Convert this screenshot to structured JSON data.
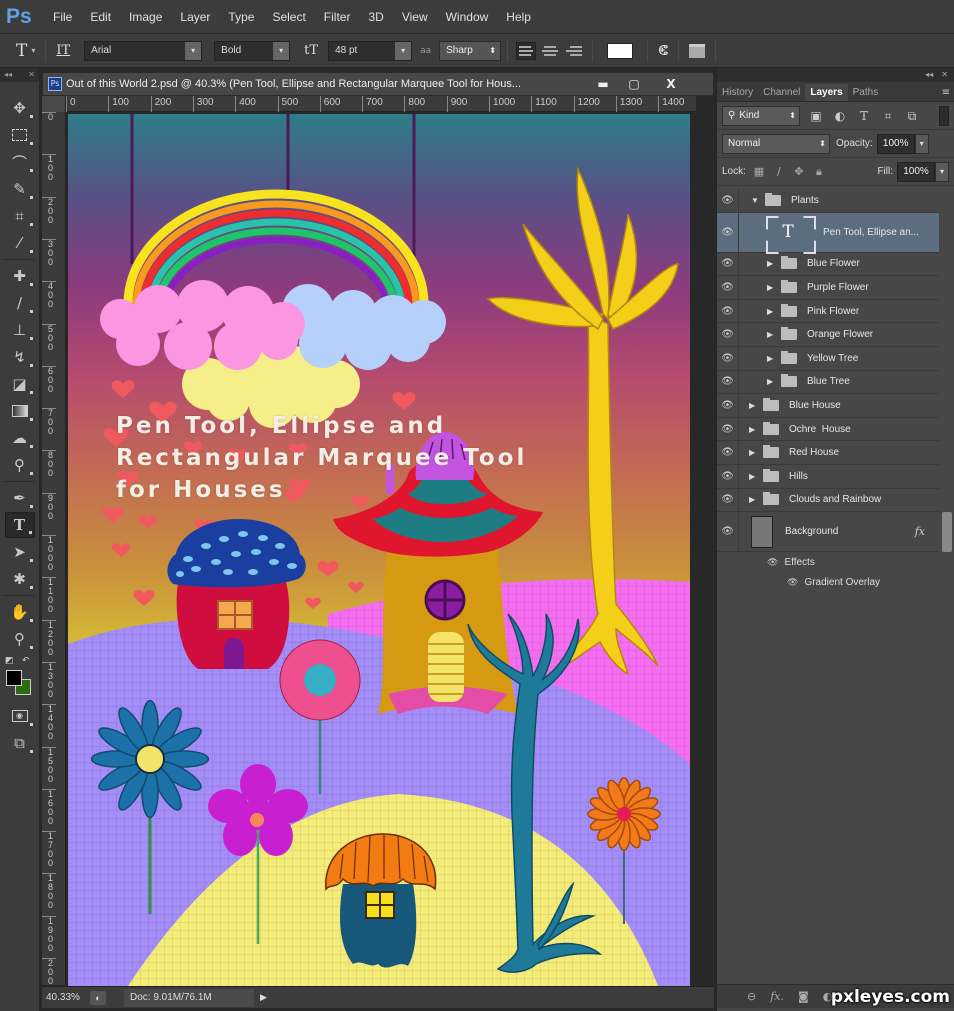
{
  "app": {
    "logo": "Ps",
    "watermark": "pxleyes.com"
  },
  "menu": [
    "File",
    "Edit",
    "Image",
    "Layer",
    "Type",
    "Select",
    "Filter",
    "3D",
    "View",
    "Window",
    "Help"
  ],
  "options": {
    "tool_icon": "T",
    "orientation_icon": "IT",
    "font_family": "Arial",
    "font_style": "Bold",
    "size_icon": "tT",
    "font_size": "48 pt",
    "aa_icon": "aa",
    "antialias": "Sharp",
    "alignment": [
      "left",
      "center",
      "right"
    ],
    "active_alignment": "left",
    "text_color": "#ffffff"
  },
  "document": {
    "title": "Out of this World 2.psd @ 40.3% (Pen Tool, Ellipse and  Rectangular Marquee Tool for Hous...",
    "icon": "Ps",
    "minimize": "▬",
    "maximize": "▢",
    "close": "X",
    "h_ruler": [
      "0",
      "100",
      "200",
      "300",
      "400",
      "500",
      "600",
      "700",
      "800",
      "900",
      "1000",
      "1100",
      "1200",
      "1300",
      "1400"
    ],
    "v_ruler": [
      "0",
      "100",
      "200",
      "300",
      "400",
      "500",
      "600",
      "700",
      "800",
      "900",
      "1000",
      "1100",
      "1200",
      "1300",
      "1400",
      "1500",
      "1600",
      "1700",
      "1800",
      "1900",
      "2000"
    ],
    "canvas_text": [
      "Pen Tool, Ellipse and",
      "Rectangular Marquee Tool",
      "for Houses"
    ],
    "zoom": "40.33%",
    "doc_info": "Doc: 9.01M/76.1M",
    "more": "▶"
  },
  "tools": [
    "move",
    "rectangular-marquee",
    "lasso",
    "quick-selection",
    "crop",
    "eyedropper",
    "spot-healing",
    "brush",
    "clone-stamp",
    "history-brush",
    "eraser",
    "gradient",
    "blur",
    "dodge",
    "pen",
    "type",
    "path-selection",
    "custom-shape",
    "hand",
    "zoom"
  ],
  "active_tool": "type",
  "colors": {
    "foreground": "#000000",
    "background": "#2d6b10"
  },
  "panel": {
    "tabs": [
      "History",
      "Channel",
      "Layers",
      "Paths"
    ],
    "active_tab": "Layers",
    "filter_kind": "Kind",
    "blend_mode": "Normal",
    "opacity_label": "Opacity:",
    "opacity": "100%",
    "lock_label": "Lock:",
    "fill_label": "Fill:",
    "fill": "100%",
    "layers": [
      {
        "name": "Plants",
        "type": "group",
        "open": true,
        "level": 0
      },
      {
        "name": "Pen Tool, Ellipse an...",
        "type": "text",
        "level": 1,
        "selected": true
      },
      {
        "name": "Blue Flower",
        "type": "group",
        "level": 1
      },
      {
        "name": "Purple Flower",
        "type": "group",
        "level": 1
      },
      {
        "name": "Pink Flower",
        "type": "group",
        "level": 1
      },
      {
        "name": "Orange Flower",
        "type": "group",
        "level": 1
      },
      {
        "name": "Yellow Tree",
        "type": "group",
        "level": 1
      },
      {
        "name": "Blue Tree",
        "type": "group",
        "level": 1
      },
      {
        "name": "Blue House",
        "type": "group",
        "level": 0
      },
      {
        "name": "Ochre  House",
        "type": "group",
        "level": 0
      },
      {
        "name": "Red House",
        "type": "group",
        "level": 0
      },
      {
        "name": "Hills",
        "type": "group",
        "level": 0
      },
      {
        "name": "Clouds and Rainbow",
        "type": "group",
        "level": 0
      },
      {
        "name": "Background",
        "type": "pixel",
        "level": 0,
        "fx": "fx"
      }
    ],
    "effects_label": "Effects",
    "effect": "Gradient Overlay",
    "bottom_icons": [
      "link",
      "fx",
      "mask",
      "adjustment",
      "group",
      "new-layer",
      "delete"
    ]
  }
}
